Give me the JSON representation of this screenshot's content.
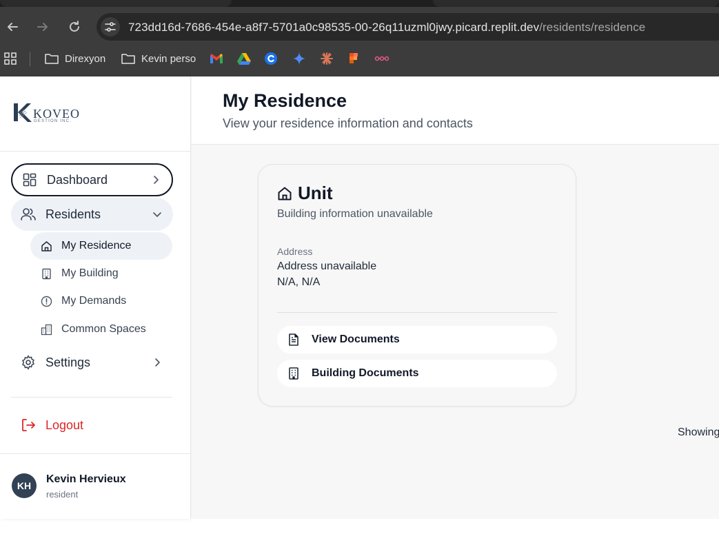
{
  "browser": {
    "url_host": "723dd16d-7686-454e-a8f7-5701a0c98535-00-26q11uzml0jwy.picard.replit.dev",
    "url_path": "/residents/residence",
    "bookmarks": [
      {
        "label": "Direxyon",
        "icon": "folder-icon"
      },
      {
        "label": "Kevin perso",
        "icon": "folder-icon"
      }
    ],
    "bookmark_icons": [
      "gmail-icon",
      "drive-icon",
      "c-icon",
      "gemini-icon",
      "claude-icon",
      "figma-icon",
      "link-icon"
    ]
  },
  "sidebar": {
    "logo_text": "KOVEO",
    "logo_subtext": "GESTION INC.",
    "dashboard_label": "Dashboard",
    "residents_label": "Residents",
    "sub_items": [
      {
        "label": "My Residence",
        "icon": "home-icon",
        "active": true
      },
      {
        "label": "My Building",
        "icon": "building-icon",
        "active": false
      },
      {
        "label": "My Demands",
        "icon": "alert-circle-icon",
        "active": false
      },
      {
        "label": "Common Spaces",
        "icon": "buildings-icon",
        "active": false
      }
    ],
    "settings_label": "Settings",
    "logout_label": "Logout",
    "user": {
      "initials": "KH",
      "name": "Kevin Hervieux",
      "role": "resident"
    }
  },
  "main": {
    "title": "My Residence",
    "subtitle": "View your residence information and contacts",
    "card": {
      "title": "Unit",
      "subtitle": "Building information unavailable",
      "address_label": "Address",
      "address_line1": "Address unavailable",
      "address_line2": "N/A, N/A",
      "view_documents_label": "View Documents",
      "building_documents_label": "Building Documents"
    },
    "showing_text": "Showing"
  },
  "colors": {
    "accent_danger": "#dc2626",
    "active_bg": "#eef2f7",
    "chrome_bg": "#3c3c3c"
  }
}
